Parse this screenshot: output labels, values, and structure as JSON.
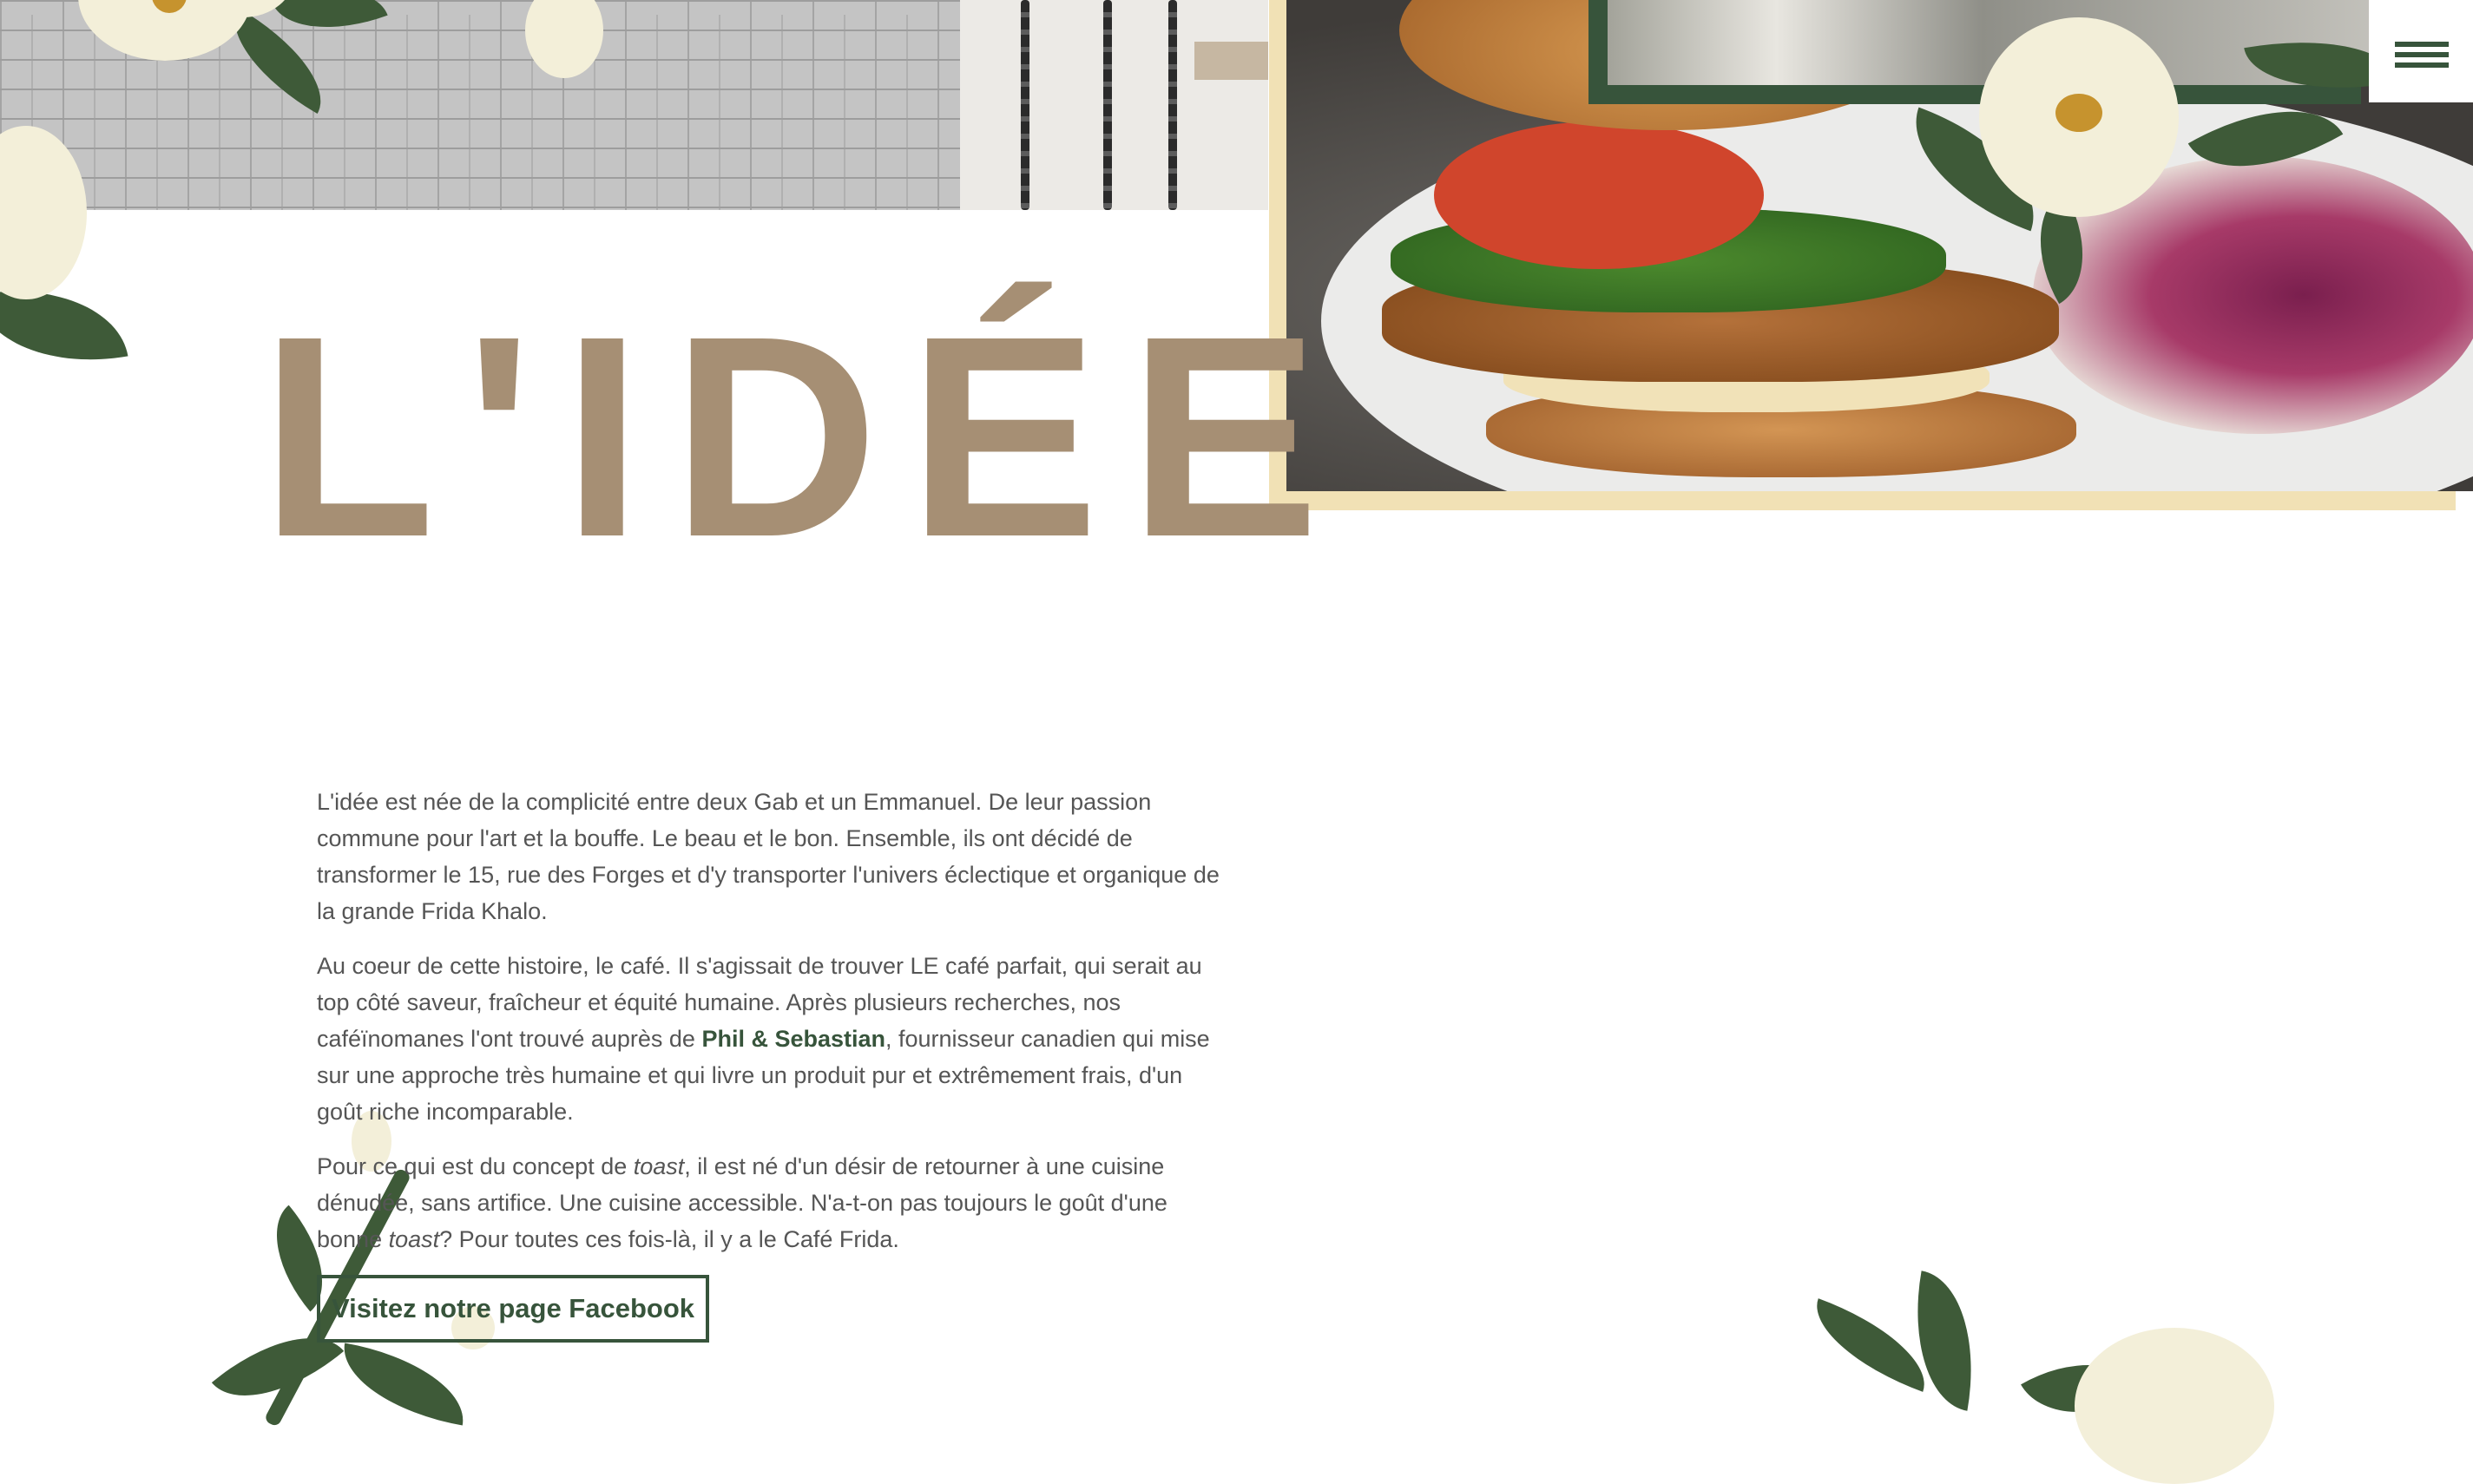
{
  "header": {
    "title": "L'IDÉE",
    "menu_icon": "hamburger-menu-icon"
  },
  "content": {
    "p1": "L'idée est née de la complicité entre deux Gab et un Emmanuel. De leur passion commune pour l'art et la bouffe. Le beau et le bon. Ensemble, ils ont décidé de transformer le 15, rue des Forges et d'y transporter l'univers éclectique et organique de la grande Frida Khalo.",
    "p2_before": "Au coeur de cette histoire, le café. Il s'agissait de trouver LE café parfait, qui serait au top côté saveur, fraîcheur et équité humaine. Après plusieurs recherches, nos caféïnomanes l'ont trouvé auprès de ",
    "p2_link": "Phil & Sebastian",
    "p2_after": ", fournisseur canadien qui mise sur une approche très humaine et qui livre un produit pur et extrêmement frais, d'un goût riche incomparable.",
    "p3_a": "Pour ce qui est du concept de ",
    "p3_em1": "toast",
    "p3_b": ", il est né d'un désir de retourner à une cuisine dénudée, sans artifice. Une cuisine accessible. N'a-t-on pas toujours le goût d'une bonne ",
    "p3_em2": "toast",
    "p3_c": "? Pour toutes ces fois-là, il y a le Café Frida."
  },
  "cta": {
    "facebook_label": "Visitez notre page Facebook"
  },
  "colors": {
    "brand_green": "#37543b",
    "title_tan": "#a68f74",
    "frame_cream": "#f1e1b5"
  }
}
